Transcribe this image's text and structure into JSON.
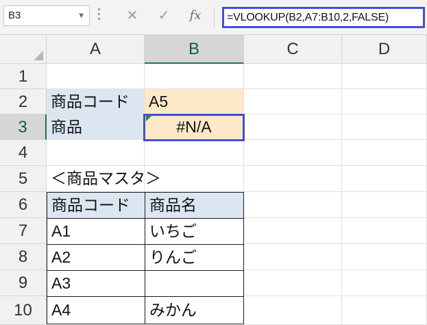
{
  "name_box": {
    "value": "B3",
    "dropdown_icon": "chevron-down-icon"
  },
  "formula_bar": {
    "cancel_icon": "close-icon",
    "enter_icon": "check-icon",
    "insert_function_label": "fx",
    "formula": "=VLOOKUP(B2,A7:B10,2,FALSE)"
  },
  "columns": [
    "A",
    "B",
    "C",
    "D"
  ],
  "rows": [
    "1",
    "2",
    "3",
    "4",
    "5",
    "6",
    "7",
    "8",
    "9",
    "10"
  ],
  "selected_cell": "B3",
  "cells": {
    "A2": "商品コード",
    "B2": "A5",
    "A3": "商品",
    "B3": "#N/A",
    "A5": "＜商品マスタ＞",
    "A6": "商品コード",
    "B6": "商品名",
    "A7": "A1",
    "B7": "いちご",
    "A8": "A2",
    "B8": "りんご",
    "A9": "A3",
    "B9": "",
    "A10": "A4",
    "B10": "みかん"
  },
  "colors": {
    "header_fill": "#dce6f1",
    "input_fill": "#fde9c8",
    "highlight_border": "#4450d4",
    "error_indicator": "#1e8a3c"
  }
}
